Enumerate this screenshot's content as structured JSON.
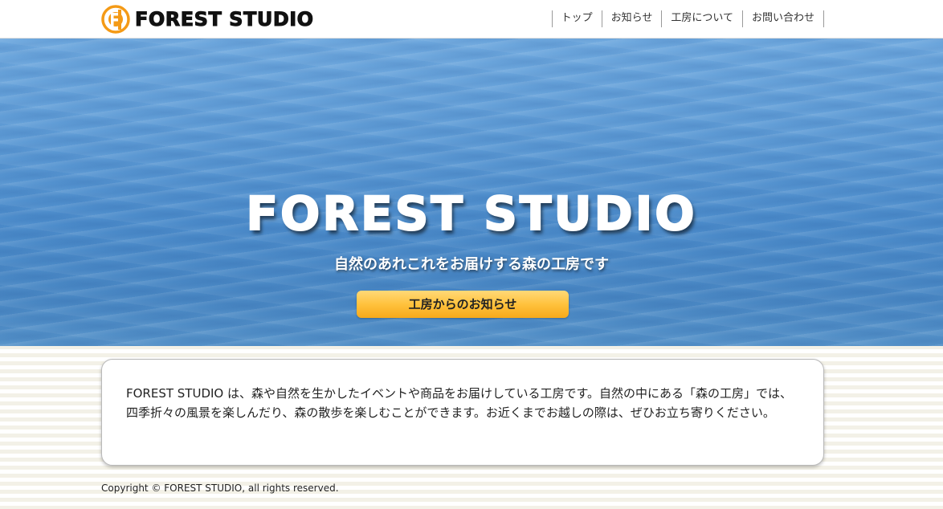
{
  "header": {
    "logo_text": "FOREST STUDIO",
    "logo_icon": "forest-studio-logo-icon",
    "nav": [
      {
        "label": "トップ"
      },
      {
        "label": "お知らせ"
      },
      {
        "label": "工房について"
      },
      {
        "label": "お問い合わせ"
      }
    ]
  },
  "hero": {
    "title": "FOREST STUDIO",
    "subtitle": "自然のあれこれをお届けする森の工房です",
    "button_label": "工房からのお知らせ"
  },
  "intro": {
    "text": "FOREST STUDIO は、森や自然を生かしたイベントや商品をお届けしている工房です。自然の中にある「森の工房」では、四季折々の風景を楽しんだり、森の散歩を楽しむことができます。お近くまでお越しの際は、ぜひお立ち寄りください。"
  },
  "footer": {
    "copyright": "Copyright © FOREST STUDIO, all rights reserved."
  },
  "colors": {
    "accent": "#f7a91a",
    "logo_orange": "#f49a16",
    "hero_water": "#5f9cd6"
  }
}
